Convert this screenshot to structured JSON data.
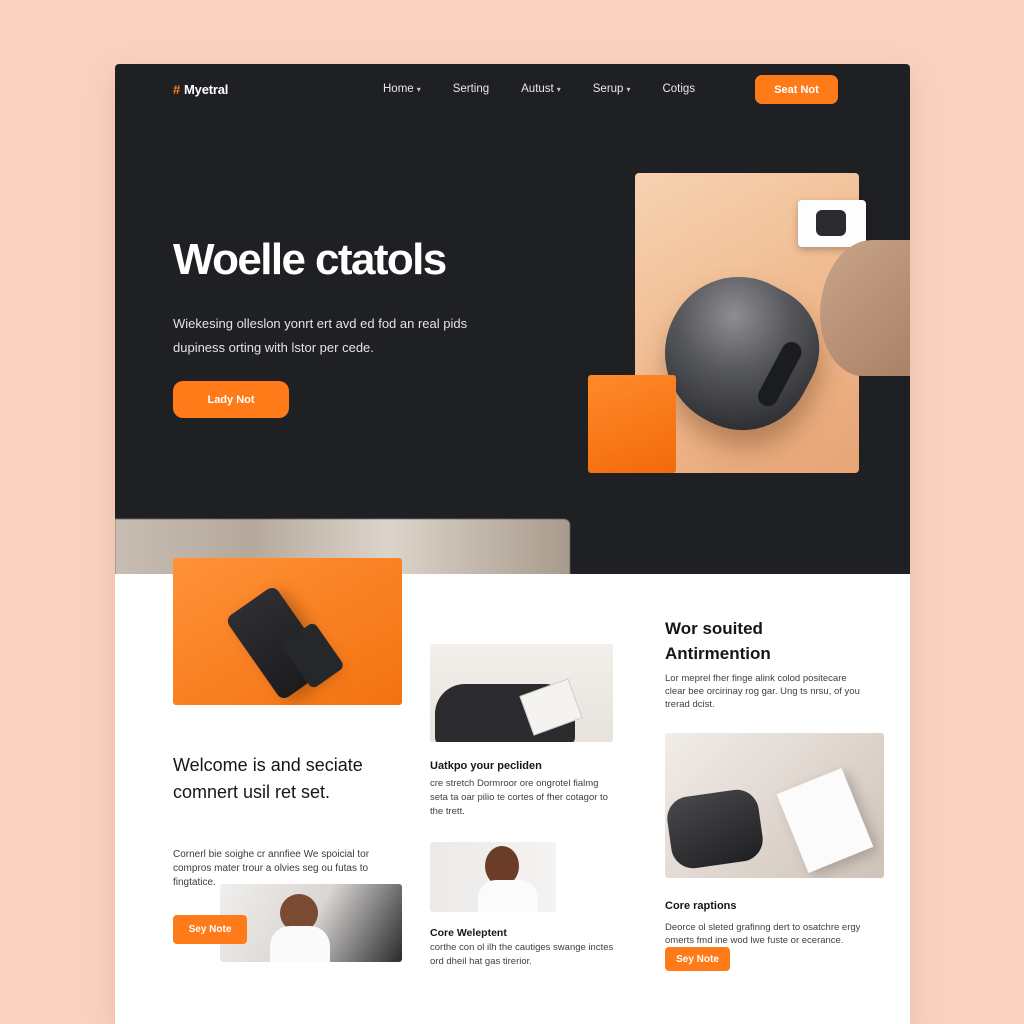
{
  "header": {
    "logo_mark": "#",
    "logo": "Myetral",
    "nav": [
      {
        "label": "Home",
        "dropdown": true
      },
      {
        "label": "Serting",
        "dropdown": false
      },
      {
        "label": "Autust",
        "dropdown": true
      },
      {
        "label": "Serup",
        "dropdown": true
      },
      {
        "label": "Cotigs",
        "dropdown": false
      }
    ],
    "cta": "Seat Not"
  },
  "hero": {
    "title": "Woelle ctatols",
    "subtitle": "Wiekesing olleslon yonrt ert avd ed fod an real pids dupiness orting with lstor per cede.",
    "button": "Lady Not"
  },
  "left": {
    "title": "Welcome is and seciate comnert usil ret set.",
    "text": "Cornerl bie soighe cr annfiee We spoicial tor compros mater trour a olvies seg ou futas to fingtatice.",
    "button": "Sey Note"
  },
  "middle": {
    "card1_title": "Uatkpo your pecliden",
    "card1_text": "cre stretch Dormroor ore ongrotel fialmg seta ta oar pilio te cortes of fher cotagor to the trett.",
    "card2_title": "Core Weleptent",
    "card2_text": "corthe con ol ilh the cautiges swange inctes ord dheil hat gas tirerior."
  },
  "right": {
    "title": "Wor souited Antirmention",
    "text": "Lor meprel fher finge alink colod positecare clear bee orcirinay rog gar. Ung ts nrsu, of you trerad dcist.",
    "title2": "Core raptions",
    "text2": "Deorce ol sleted grafinng dert to osatchre ergy omerts fmd ine wod lwe fuste or ecerance.",
    "button": "Sey Note"
  },
  "colors": {
    "accent": "#ff7a18",
    "dark": "#1f2024",
    "background": "#f9d2bf"
  }
}
